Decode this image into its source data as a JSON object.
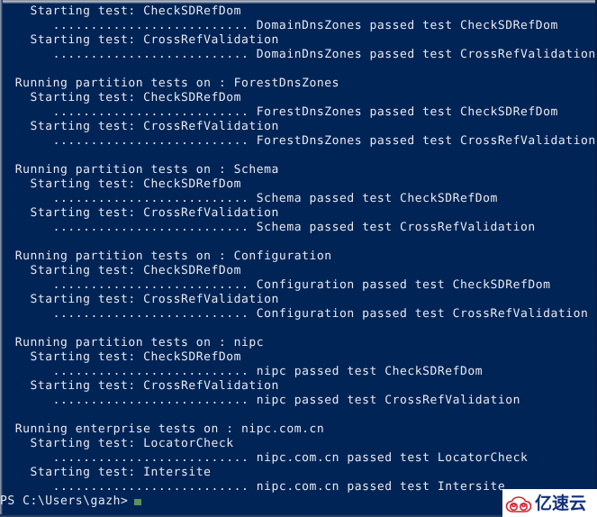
{
  "window": {
    "app": "Windows PowerShell",
    "background_color": "#012456",
    "foreground_color": "#e8eaf0",
    "cursor_color": "#5e8f5e"
  },
  "console": {
    "dots": "..........................",
    "lines": [
      "    Starting test: CheckSDRefDom",
      "       .......................... DomainDnsZones passed test CheckSDRefDom",
      "    Starting test: CrossRefValidation",
      "       .......................... DomainDnsZones passed test CrossRefValidation",
      "",
      "  Running partition tests on : ForestDnsZones",
      "    Starting test: CheckSDRefDom",
      "       .......................... ForestDnsZones passed test CheckSDRefDom",
      "    Starting test: CrossRefValidation",
      "       .......................... ForestDnsZones passed test CrossRefValidation",
      "",
      "  Running partition tests on : Schema",
      "    Starting test: CheckSDRefDom",
      "       .......................... Schema passed test CheckSDRefDom",
      "    Starting test: CrossRefValidation",
      "       .......................... Schema passed test CrossRefValidation",
      "",
      "  Running partition tests on : Configuration",
      "    Starting test: CheckSDRefDom",
      "       .......................... Configuration passed test CheckSDRefDom",
      "    Starting test: CrossRefValidation",
      "       .......................... Configuration passed test CrossRefValidation",
      "",
      "  Running partition tests on : nipc",
      "    Starting test: CheckSDRefDom",
      "       .......................... nipc passed test CheckSDRefDom",
      "    Starting test: CrossRefValidation",
      "       .......................... nipc passed test CrossRefValidation",
      "",
      "  Running enterprise tests on : nipc.com.cn",
      "    Starting test: LocatorCheck",
      "       .......................... nipc.com.cn passed test LocatorCheck",
      "    Starting test: Intersite",
      "       .......................... nipc.com.cn passed test Intersite"
    ]
  },
  "prompt": {
    "text": "PS C:\\Users\\gazh>",
    "cursor": "block-cursor"
  },
  "watermark": {
    "text": "亿速云",
    "logo": "cloud-logo",
    "logo_color": "#d4232f",
    "text_color": "#13307a",
    "background_color": "#ffffff"
  }
}
